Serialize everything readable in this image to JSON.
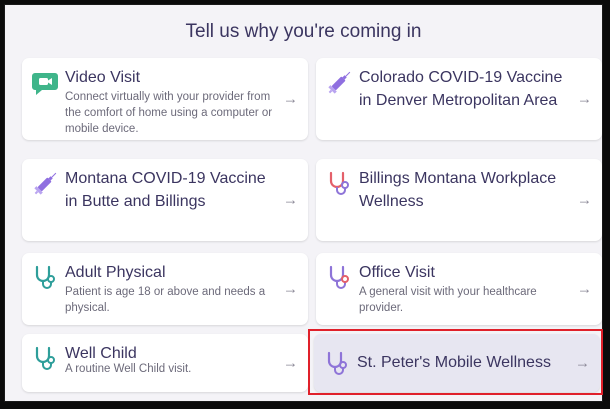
{
  "header": {
    "title": "Tell us why you're coming in"
  },
  "cards": [
    {
      "title": "Video Visit",
      "desc": "Connect virtually with your provider from the comfort of home using a computer or mobile device.",
      "icon": "video-icon",
      "arrow": "→"
    },
    {
      "title": "Colorado COVID-19 Vaccine in Denver Metropolitan Area",
      "desc": "",
      "icon": "syringe-icon",
      "arrow": "→"
    },
    {
      "title": "Montana COVID-19 Vaccine in Butte and Billings",
      "desc": "",
      "icon": "syringe-icon",
      "arrow": "→"
    },
    {
      "title": "Billings Montana Workplace Wellness",
      "desc": "",
      "icon": "stethoscope-icon",
      "arrow": "→"
    },
    {
      "title": "Adult Physical",
      "desc": "Patient is age 18 or above and needs a physical.",
      "icon": "stethoscope-icon",
      "arrow": "→"
    },
    {
      "title": "Office Visit",
      "desc": "A general visit with your healthcare provider.",
      "icon": "stethoscope-icon",
      "arrow": "→"
    },
    {
      "title": "Well Child",
      "desc": "A routine Well Child visit.",
      "icon": "stethoscope-icon",
      "arrow": "→"
    },
    {
      "title": "St. Peter's Mobile Wellness",
      "desc": "",
      "icon": "stethoscope-icon",
      "arrow": "→",
      "selected": true
    }
  ],
  "colors": {
    "accent_text": "#3b3560",
    "video_icon": "#3fb58a",
    "syringe_icon": "#8f6fe0",
    "stethoscope_teal": "#2e9e9a",
    "stethoscope_red": "#e4606a",
    "stethoscope_purple": "#8e74d8",
    "highlight_border": "#e0202a"
  }
}
